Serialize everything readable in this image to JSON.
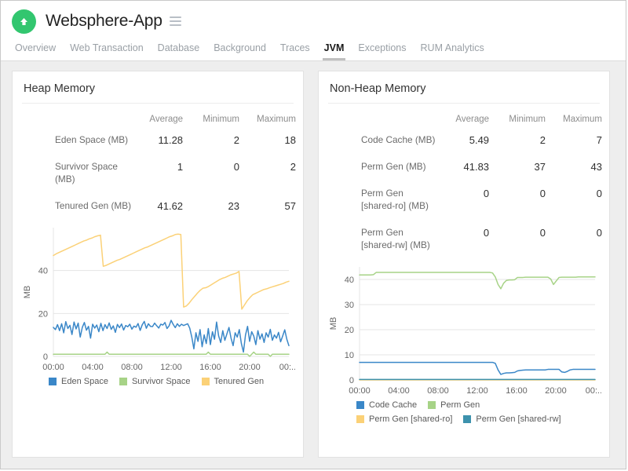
{
  "header": {
    "logo_icon": "up-arrow-circle-icon",
    "app_title": "Websphere-App",
    "menu_icon": "hamburger-icon",
    "tabs": [
      {
        "label": "Overview",
        "active": false
      },
      {
        "label": "Web Transaction",
        "active": false
      },
      {
        "label": "Database",
        "active": false
      },
      {
        "label": "Background",
        "active": false
      },
      {
        "label": "Traces",
        "active": false
      },
      {
        "label": "JVM",
        "active": true
      },
      {
        "label": "Exceptions",
        "active": false
      },
      {
        "label": "RUM Analytics",
        "active": false
      }
    ]
  },
  "colors": {
    "brand_green": "#32c66f",
    "series_blue": "#3a87c8",
    "series_green": "#a7d387",
    "series_yellow": "#fbd177",
    "series_teal": "#3d92ad",
    "page_bg": "#eeeeee",
    "panel_bg": "#ffffff",
    "grid": "#e4e4e4"
  },
  "panels": [
    {
      "title": "Heap Memory",
      "table": {
        "row_label_header": "",
        "columns": [
          "Average",
          "Minimum",
          "Maximum"
        ],
        "rows": [
          {
            "name": "Eden Space (MB)",
            "values": [
              "11.28",
              "2",
              "18"
            ]
          },
          {
            "name": "Survivor Space (MB)",
            "values": [
              "1",
              "0",
              "2"
            ]
          },
          {
            "name": "Tenured Gen (MB)",
            "values": [
              "41.62",
              "23",
              "57"
            ]
          }
        ]
      },
      "legend": [
        {
          "label": "Eden Space",
          "color": "#3a87c8"
        },
        {
          "label": "Survivor Space",
          "color": "#a7d387"
        },
        {
          "label": "Tenured Gen",
          "color": "#fbd177"
        }
      ]
    },
    {
      "title": "Non-Heap Memory",
      "table": {
        "row_label_header": "",
        "columns": [
          "Average",
          "Minimum",
          "Maximum"
        ],
        "rows": [
          {
            "name": "Code Cache (MB)",
            "values": [
              "5.49",
              "2",
              "7"
            ]
          },
          {
            "name": "Perm Gen (MB)",
            "values": [
              "41.83",
              "37",
              "43"
            ]
          },
          {
            "name": "Perm Gen [shared-ro] (MB)",
            "values": [
              "0",
              "0",
              "0"
            ]
          },
          {
            "name": "Perm Gen [shared-rw] (MB)",
            "values": [
              "0",
              "0",
              "0"
            ]
          }
        ]
      },
      "legend": [
        {
          "label": "Code Cache",
          "color": "#3a87c8"
        },
        {
          "label": "Perm Gen",
          "color": "#a7d387"
        },
        {
          "label": "Perm Gen [shared-ro]",
          "color": "#fbd177"
        },
        {
          "label": "Perm Gen [shared-rw]",
          "color": "#3d92ad"
        }
      ]
    }
  ],
  "chart_data": [
    {
      "type": "line",
      "title": "Heap Memory",
      "xlabel": "",
      "ylabel": "MB",
      "xticklabels": [
        "00:00",
        "04:00",
        "08:00",
        "12:00",
        "16:00",
        "20:00",
        "00:..."
      ],
      "yticks": [
        0,
        20,
        40
      ],
      "ylim": [
        0,
        60
      ],
      "grid": true,
      "legend_position": "bottom",
      "series": [
        {
          "name": "Eden Space",
          "color": "#3a87c8",
          "values": [
            13.5,
            12.5,
            14.8,
            12.0,
            15.2,
            11.0,
            16.2,
            13.0,
            14.5,
            10.2,
            16.0,
            12.8,
            15.5,
            9.0,
            13.5,
            15.8,
            12.2,
            14.0,
            8.5,
            15.0,
            13.2,
            14.6,
            11.5,
            15.4,
            12.0,
            14.8,
            13.0,
            15.6,
            12.6,
            14.2,
            11.2,
            14.9,
            13.4,
            15.1,
            12.3,
            14.4,
            13.8,
            15.0,
            12.7,
            14.1,
            13.6,
            15.3,
            12.1,
            14.7,
            16.3,
            13.1,
            15.2,
            14.0,
            13.9,
            15.5,
            14.3,
            13.2,
            15.0,
            14.6,
            15.8,
            13.0,
            14.2,
            16.8,
            14.9,
            13.4,
            15.2,
            14.0,
            15.0,
            14.4,
            14.8,
            15.2,
            13.2,
            9.0,
            3.5,
            11.0,
            7.0,
            12.5,
            4.5,
            10.0,
            6.0,
            13.0,
            5.5,
            11.5,
            8.0,
            16.0,
            9.5,
            6.5,
            12.0,
            7.5,
            10.5,
            13.5,
            8.5,
            5.0,
            11.0,
            9.0,
            12.5,
            6.0,
            2.0,
            10.0,
            14.0,
            7.0,
            11.5,
            9.5,
            5.5,
            12.0,
            8.0,
            10.5,
            6.5,
            11.0,
            9.0,
            12.6,
            7.5,
            10.0,
            8.5,
            11.2,
            6.8,
            9.5,
            12.4,
            8.0,
            5.0
          ]
        },
        {
          "name": "Survivor Space",
          "color": "#a7d387",
          "values": [
            1,
            1,
            1,
            1,
            1,
            1,
            1,
            1,
            1,
            1,
            1,
            1,
            1,
            1,
            1,
            1,
            1,
            1,
            1,
            1,
            1,
            1,
            1,
            1,
            1,
            1,
            2,
            1,
            1,
            1,
            1,
            1,
            1,
            1,
            1,
            1,
            1,
            1,
            1,
            1,
            1,
            1,
            1,
            1,
            1,
            1,
            1,
            1,
            1,
            1,
            1,
            1,
            1,
            1,
            1,
            1,
            1,
            1,
            1,
            1,
            1,
            1,
            1,
            1,
            1,
            1,
            1,
            1,
            1,
            1,
            1,
            1,
            1,
            1,
            1,
            2,
            1,
            1,
            1,
            1,
            1,
            1,
            1,
            1,
            1,
            1,
            1,
            1,
            1,
            1,
            1,
            1,
            1,
            1,
            1,
            0,
            1,
            2,
            1,
            1,
            1,
            1,
            1,
            1,
            1,
            0,
            1,
            1,
            1,
            1,
            1,
            1,
            1,
            1,
            1
          ]
        },
        {
          "name": "Tenured Gen",
          "color": "#fbd177",
          "values": [
            47.0,
            47.8,
            48.4,
            49.0,
            49.6,
            50.2,
            50.8,
            51.4,
            52.0,
            52.6,
            53.2,
            53.8,
            54.2,
            54.8,
            55.2,
            55.8,
            56.2,
            56.5,
            42.0,
            42.4,
            43.0,
            43.6,
            44.2,
            44.8,
            45.2,
            45.8,
            46.4,
            47.0,
            47.6,
            48.2,
            48.8,
            49.4,
            50.0,
            50.6,
            51.0,
            51.6,
            52.2,
            52.8,
            53.4,
            54.0,
            54.6,
            55.2,
            55.8,
            56.2,
            56.8,
            57.0,
            56.8,
            23.0,
            23.5,
            24.8,
            26.5,
            28.0,
            29.5,
            30.8,
            31.8,
            32.0,
            32.6,
            33.4,
            34.2,
            35.0,
            35.8,
            36.4,
            36.8,
            37.4,
            38.0,
            38.4,
            38.8,
            39.6,
            22.0,
            24.0,
            26.0,
            27.5,
            28.8,
            29.4,
            30.0,
            30.6,
            31.2,
            31.5,
            32.0,
            32.4,
            32.8,
            33.2,
            33.6,
            34.0,
            34.6,
            35.0
          ]
        }
      ]
    },
    {
      "type": "line",
      "title": "Non-Heap Memory",
      "xlabel": "",
      "ylabel": "MB",
      "xticklabels": [
        "00:00",
        "04:00",
        "08:00",
        "12:00",
        "16:00",
        "20:00",
        "00:..."
      ],
      "yticks": [
        0,
        10,
        20,
        30,
        40
      ],
      "ylim": [
        0,
        45
      ],
      "grid": true,
      "legend_position": "bottom",
      "series": [
        {
          "name": "Code Cache",
          "color": "#3a87c8",
          "values": [
            7.0,
            7.0,
            7.0,
            7.0,
            7.0,
            7.0,
            7.0,
            7.0,
            7.0,
            7.0,
            7.0,
            7.0,
            7.0,
            7.0,
            7.0,
            7.0,
            7.0,
            7.0,
            7.0,
            7.0,
            7.0,
            7.0,
            7.0,
            7.0,
            7.0,
            7.0,
            7.0,
            7.0,
            7.0,
            7.0,
            7.0,
            7.0,
            7.0,
            7.0,
            7.0,
            7.0,
            7.0,
            7.0,
            7.0,
            7.0,
            7.0,
            7.0,
            7.0,
            7.0,
            7.0,
            7.0,
            7.0,
            7.0,
            7.0,
            6.6,
            4.0,
            2.2,
            2.6,
            2.8,
            2.8,
            2.9,
            3.0,
            3.6,
            3.8,
            3.9,
            4.0,
            4.0,
            4.0,
            4.0,
            4.0,
            4.0,
            4.0,
            4.0,
            4.2,
            4.2,
            4.2,
            4.2,
            4.2,
            3.2,
            3.0,
            3.4,
            4.0,
            4.2,
            4.2,
            4.2,
            4.2,
            4.2,
            4.2,
            4.2,
            4.2,
            4.2
          ]
        },
        {
          "name": "Perm Gen",
          "color": "#a7d387",
          "values": [
            41.8,
            41.8,
            41.8,
            41.8,
            41.8,
            41.9,
            42.8,
            42.8,
            42.8,
            42.8,
            42.8,
            42.8,
            42.8,
            42.8,
            42.8,
            42.8,
            42.8,
            42.8,
            42.8,
            42.8,
            42.8,
            42.8,
            42.8,
            42.8,
            42.8,
            42.8,
            42.8,
            42.8,
            42.8,
            42.8,
            42.8,
            42.8,
            42.8,
            42.8,
            42.8,
            42.8,
            42.8,
            42.8,
            42.8,
            42.8,
            42.8,
            42.8,
            42.8,
            42.8,
            42.8,
            42.8,
            42.8,
            42.8,
            42.6,
            41.0,
            38.0,
            36.3,
            38.5,
            39.6,
            39.8,
            39.8,
            39.9,
            40.8,
            40.8,
            40.8,
            40.9,
            40.9,
            40.9,
            40.9,
            40.9,
            40.9,
            40.9,
            40.9,
            40.9,
            40.2,
            38.0,
            39.4,
            40.8,
            40.9,
            40.9,
            40.9,
            40.9,
            40.9,
            40.9,
            41.0,
            41.0,
            41.0,
            41.0,
            41.0,
            41.0,
            41.0
          ]
        },
        {
          "name": "Perm Gen [shared-ro]",
          "color": "#fbd177",
          "values": [
            0,
            0,
            0,
            0,
            0,
            0,
            0,
            0,
            0,
            0,
            0,
            0,
            0,
            0,
            0,
            0,
            0,
            0,
            0,
            0,
            0,
            0,
            0,
            0,
            0,
            0,
            0,
            0,
            0,
            0,
            0,
            0,
            0,
            0,
            0,
            0,
            0,
            0,
            0,
            0,
            0,
            0,
            0,
            0,
            0,
            0,
            0,
            0,
            0,
            0,
            0,
            0,
            0,
            0,
            0,
            0,
            0,
            0,
            0,
            0,
            0,
            0,
            0,
            0,
            0,
            0,
            0,
            0,
            0,
            0,
            0,
            0,
            0,
            0,
            0,
            0,
            0,
            0,
            0,
            0,
            0,
            0,
            0,
            0,
            0,
            0
          ]
        },
        {
          "name": "Perm Gen [shared-rw]",
          "color": "#3d92ad",
          "values": [
            0.18,
            0.18,
            0.18,
            0.18,
            0.18,
            0.18,
            0.18,
            0.18,
            0.18,
            0.18,
            0.18,
            0.18,
            0.18,
            0.18,
            0.18,
            0.18,
            0.18,
            0.18,
            0.18,
            0.18,
            0.18,
            0.18,
            0.18,
            0.18,
            0.18,
            0.18,
            0.18,
            0.18,
            0.18,
            0.18,
            0.18,
            0.18,
            0.18,
            0.18,
            0.18,
            0.18,
            0.18,
            0.18,
            0.18,
            0.18,
            0.18,
            0.18,
            0.18,
            0.18,
            0.18,
            0.18,
            0.18,
            0.18,
            0.18,
            0.18,
            0.18,
            0.18,
            0.18,
            0.18,
            0.18,
            0.18,
            0.18,
            0.18,
            0.18,
            0.18,
            0.18,
            0.18,
            0.18,
            0.18,
            0.18,
            0.18,
            0.18,
            0.18,
            0.18,
            0.18,
            0.18,
            0.18,
            0.18,
            0.18,
            0.18,
            0.18,
            0.18,
            0.18,
            0.18,
            0.18,
            0.18,
            0.18,
            0.18,
            0.18,
            0.18,
            0.18
          ]
        }
      ]
    }
  ]
}
